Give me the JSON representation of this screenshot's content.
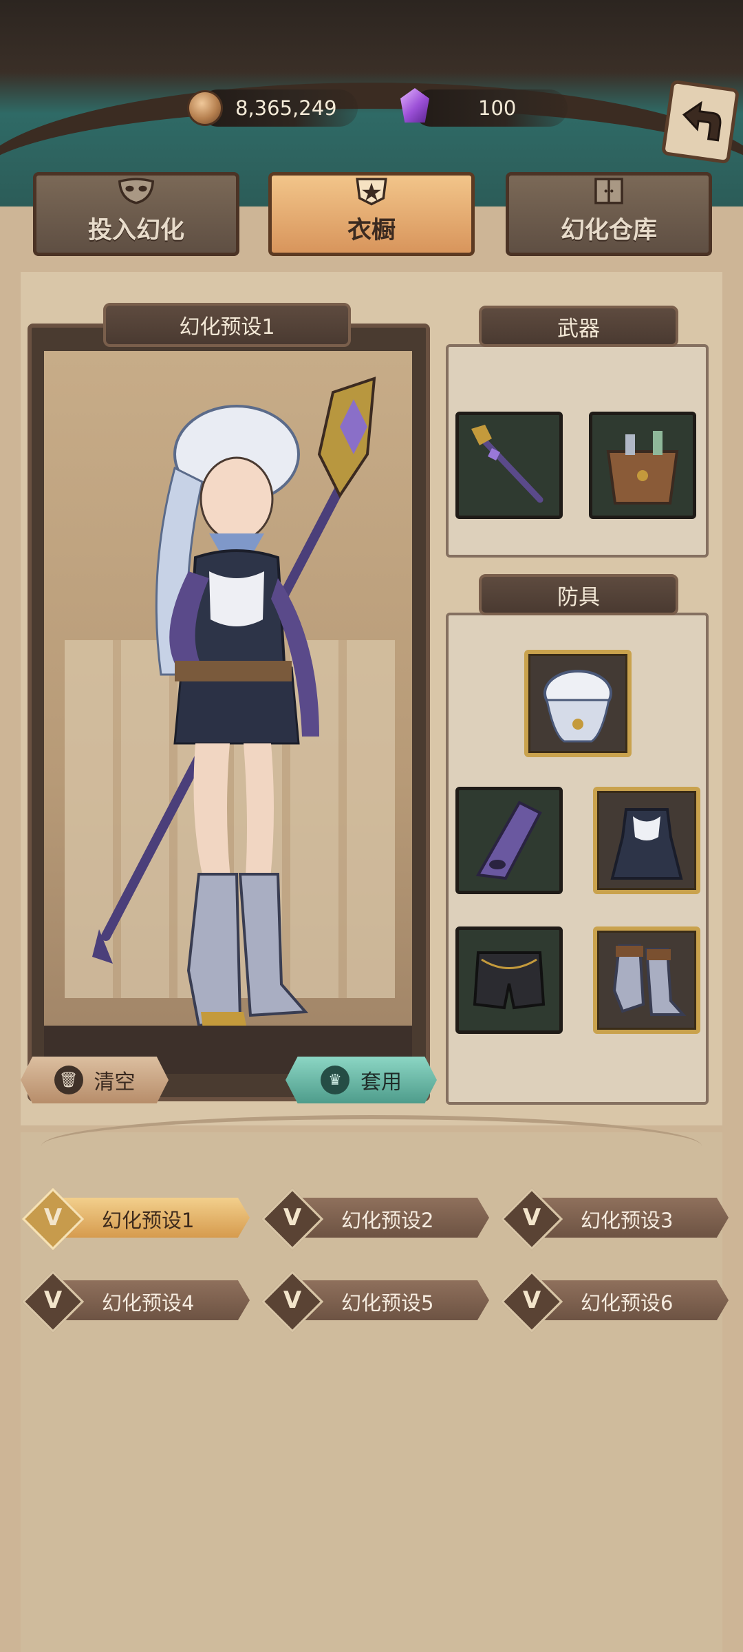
{
  "currency": {
    "coins": "8,365,249",
    "coins_icon": "coin-icon",
    "gems": "100",
    "gems_icon": "crystal-icon"
  },
  "tabs": [
    {
      "label": "投入幻化",
      "icon": "mask-icon"
    },
    {
      "label": "衣橱",
      "icon": "wardrobe-crest-icon"
    },
    {
      "label": "幻化仓库",
      "icon": "cabinet-icon"
    }
  ],
  "preset_panel": {
    "title": "幻化预设1",
    "clear_label": "清空",
    "apply_label": "套用"
  },
  "weapons": {
    "title": "武器",
    "slots": [
      "staff-icon",
      "pouch-icon"
    ]
  },
  "armor": {
    "title": "防具",
    "slots": [
      "hat-icon",
      "glove-icon",
      "dress-icon",
      "shorts-icon",
      "boots-icon"
    ]
  },
  "presets": [
    {
      "label": "幻化预设1"
    },
    {
      "label": "幻化预设2"
    },
    {
      "label": "幻化预设3"
    },
    {
      "label": "幻化预设4"
    },
    {
      "label": "幻化预设5"
    },
    {
      "label": "幻化预设6"
    }
  ],
  "colors": {
    "accent_orange": "#d8955c",
    "accent_teal": "#4e9c8b",
    "panel_bg": "#d9c6a8"
  }
}
